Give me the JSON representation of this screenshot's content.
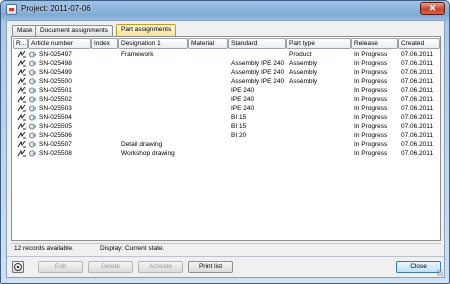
{
  "window": {
    "title": "Project: 2011-07-06"
  },
  "tabs": [
    {
      "label": "Mask"
    },
    {
      "label": "Document assignments"
    },
    {
      "label": "Part assignments"
    }
  ],
  "table": {
    "columns": [
      "R...",
      "Article number",
      "Index",
      "Designation 1",
      "Material",
      "Standard",
      "Part type",
      "Release",
      "Created"
    ],
    "rows": [
      {
        "article": "SN-025497",
        "index": "",
        "designation": "Framework",
        "material": "",
        "standard": "",
        "part_type": "Product",
        "release": "In Progress",
        "created": "07.06.2011"
      },
      {
        "article": "SN-025498",
        "index": "",
        "designation": "",
        "material": "",
        "standard": "Assembly IPE 240",
        "part_type": "Assembly",
        "release": "In Progress",
        "created": "07.06.2011"
      },
      {
        "article": "SN-025499",
        "index": "",
        "designation": "",
        "material": "",
        "standard": "Assembly IPE 240",
        "part_type": "Assembly",
        "release": "In Progress",
        "created": "07.06.2011"
      },
      {
        "article": "SN-025500",
        "index": "",
        "designation": "",
        "material": "",
        "standard": "Assembly IPE 240",
        "part_type": "Assembly",
        "release": "In Progress",
        "created": "07.06.2011"
      },
      {
        "article": "SN-025501",
        "index": "",
        "designation": "",
        "material": "",
        "standard": "IPE 240",
        "part_type": "",
        "release": "In Progress",
        "created": "07.06.2011"
      },
      {
        "article": "SN-025502",
        "index": "",
        "designation": "",
        "material": "",
        "standard": "IPE 240",
        "part_type": "",
        "release": "In Progress",
        "created": "07.06.2011"
      },
      {
        "article": "SN-025503",
        "index": "",
        "designation": "",
        "material": "",
        "standard": "IPE 240",
        "part_type": "",
        "release": "In Progress",
        "created": "07.06.2011"
      },
      {
        "article": "SN-025504",
        "index": "",
        "designation": "",
        "material": "",
        "standard": "BI 15",
        "part_type": "",
        "release": "In Progress",
        "created": "07.06.2011"
      },
      {
        "article": "SN-025505",
        "index": "",
        "designation": "",
        "material": "",
        "standard": "BI 15",
        "part_type": "",
        "release": "In Progress",
        "created": "07.06.2011"
      },
      {
        "article": "SN-025506",
        "index": "",
        "designation": "",
        "material": "",
        "standard": "BI 20",
        "part_type": "",
        "release": "In Progress",
        "created": "07.06.2011"
      },
      {
        "article": "SN-025507",
        "index": "",
        "designation": "Detail drawing",
        "material": "",
        "standard": "",
        "part_type": "",
        "release": "In Progress",
        "created": "07.06.2011"
      },
      {
        "article": "SN-025508",
        "index": "",
        "designation": "Workshop drawing",
        "material": "",
        "standard": "",
        "part_type": "",
        "release": "In Progress",
        "created": "07.06.2011"
      }
    ]
  },
  "status": {
    "records": "12 records available.",
    "display": "Display: Current state."
  },
  "buttons": {
    "edit": "Edit",
    "delete": "Delete",
    "activate": "Activate",
    "print": "Print list",
    "close": "Close"
  },
  "colors": {
    "accent_tab": "#f7e19a",
    "close_titlebar": "#c6452c",
    "table_bg": "#ffffff"
  }
}
